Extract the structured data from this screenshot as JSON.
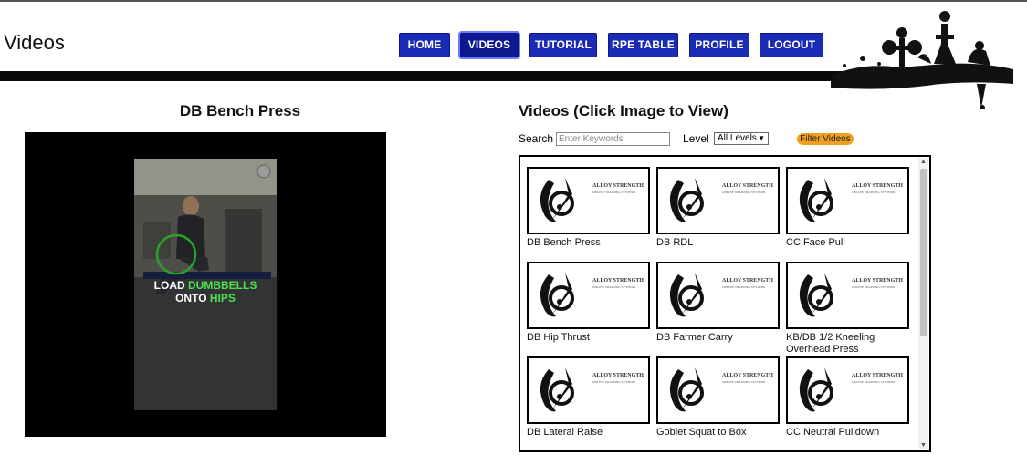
{
  "page": {
    "title": "Videos"
  },
  "nav": {
    "items": [
      {
        "label": "HOME"
      },
      {
        "label": "VIDEOS",
        "active": true
      },
      {
        "label": "TUTORIAL"
      },
      {
        "label": "RPE TABLE"
      },
      {
        "label": "PROFILE"
      },
      {
        "label": "LOGOUT"
      }
    ]
  },
  "player": {
    "title": "DB Bench Press",
    "overlay_line1_white": "LOAD ",
    "overlay_line1_green": "DUMBBELLS",
    "overlay_line2_white": "ONTO ",
    "overlay_line2_green": "HIPS"
  },
  "gallery": {
    "title": "Videos (Click Image to View)",
    "search_label": "Search",
    "search_placeholder": "Enter Keywords",
    "level_label": "Level",
    "level_selected": "All Levels",
    "filter_label": "Filter Videos",
    "thumb_text_line1": "ALLOY STRENGTH",
    "thumb_text_line2": "ONLINE TRAINING SYSTEMS",
    "videos": [
      {
        "name": "DB Bench Press"
      },
      {
        "name": "DB RDL"
      },
      {
        "name": "CC Face Pull"
      },
      {
        "name": "DB Hip Thrust"
      },
      {
        "name": "DB Farmer Carry"
      },
      {
        "name": "KB/DB 1/2 Kneeling Overhead Press"
      },
      {
        "name": "DB Lateral Raise"
      },
      {
        "name": "Goblet Squat to Box"
      },
      {
        "name": "CC Neutral Pulldown"
      }
    ]
  },
  "colors": {
    "nav_bg": "#1a2bb5",
    "filter_bg": "#f0a020",
    "overlay_green": "#4ee04e"
  },
  "icons": {
    "logo": "fitness-silhouette-logo",
    "thumb": "alloy-strength-logo-icon"
  }
}
